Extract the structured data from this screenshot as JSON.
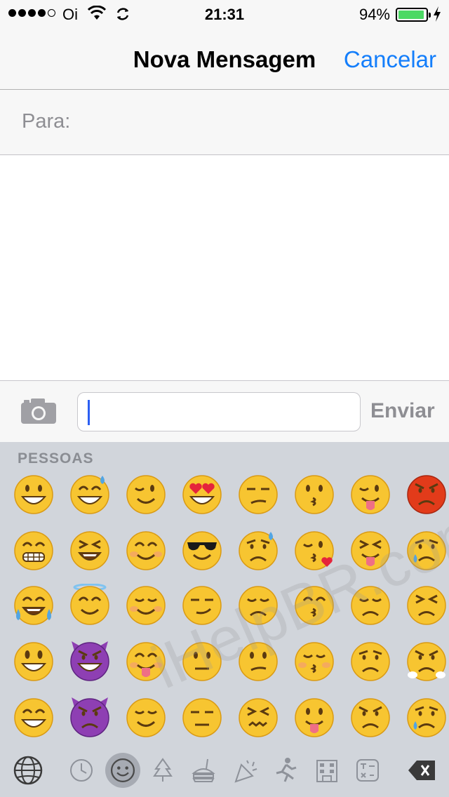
{
  "status_bar": {
    "carrier": "Oi",
    "time": "21:31",
    "battery": "94%",
    "battery_level": 0.94
  },
  "nav": {
    "title": "Nova Mensagem",
    "cancel_label": "Cancelar"
  },
  "recipient": {
    "label": "Para:"
  },
  "compose": {
    "send_label": "Enviar",
    "input_value": ""
  },
  "keyboard": {
    "category_label": "PESSOAS",
    "watermark": "iHelpBR.com",
    "emojis": [
      [
        "grinning-face",
        "grinning-sweat-face",
        "winking-face",
        "heart-eyes-face",
        "unamused-face",
        "kissing-face",
        "winking-tongue-face",
        "pouting-red-face"
      ],
      [
        "grimacing-face",
        "laughing-squint-face",
        "smiling-blush-face",
        "sunglasses-face",
        "cold-sweat-face",
        "blowing-kiss-face",
        "squinting-tongue-face",
        "crying-face"
      ],
      [
        "tears-of-joy-face",
        "halo-face",
        "relieved-face",
        "smirking-face",
        "pensive-face",
        "kissing-smiling-eyes-face",
        "disappointed-face",
        "persevering-face"
      ],
      [
        "smiling-open-face",
        "smiling-devil-face",
        "yummy-face",
        "neutral-face",
        "confused-face",
        "kissing-closed-eyes-face",
        "worried-face",
        "triumph-face"
      ],
      [
        "grinning-open-face",
        "angry-devil-face",
        "relieved-content-face",
        "expressionless-face",
        "confounded-face",
        "tongue-out-face",
        "angry-face",
        "sad-sweat-face"
      ]
    ],
    "bottom_bar": [
      "globe-icon",
      "recent-clock-icon",
      "smiley-icon",
      "nature-tree-icon",
      "food-icon",
      "celebration-icon",
      "activity-runner-icon",
      "places-building-icon",
      "symbols-icon",
      "delete-icon"
    ],
    "active_category": "smiley-icon",
    "colors": {
      "face": "#f7c531",
      "face_edge": "#d99a14",
      "devil": "#8e3fb3",
      "angry_red": "#e23b1a",
      "heart": "#e5243b",
      "tongue": "#ef6f86",
      "tear": "#52a5e3"
    }
  },
  "colors": {
    "accent": "#147efb",
    "battery_fill": "#4cd964",
    "caret": "#2b5ff3"
  }
}
